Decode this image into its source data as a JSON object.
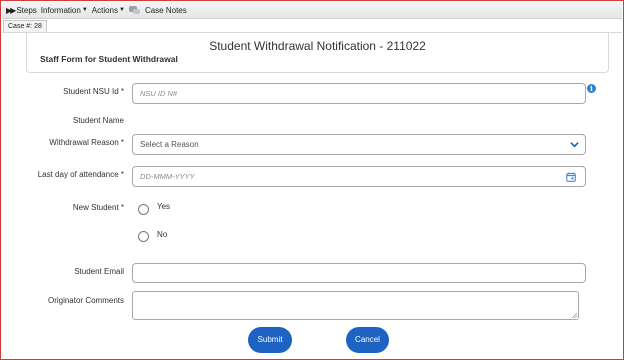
{
  "toolbar": {
    "steps_label": "Steps",
    "information_label": "Information",
    "actions_label": "Actions",
    "case_notes_label": "Case Notes"
  },
  "case_tab": {
    "label": "Case #: 28"
  },
  "header": {
    "title": "Student Withdrawal Notification - 211022",
    "form_title": "Staff Form for Student Withdrawal"
  },
  "form": {
    "student_nsu_id": {
      "label": "Student NSU Id *",
      "placeholder": "NSU ID N#",
      "value": ""
    },
    "student_name": {
      "label": "Student Name"
    },
    "withdrawal_reason": {
      "label": "Withdrawal Reason *",
      "selected": "Select a Reason"
    },
    "last_day": {
      "label": "Last day of attendance *",
      "placeholder": "DD-MMM-YYYY"
    },
    "new_student": {
      "label": "New Student *",
      "options": [
        "Yes",
        "No"
      ]
    },
    "student_email": {
      "label": "Student Email",
      "value": ""
    },
    "originator_comments": {
      "label": "Originator Comments",
      "value": ""
    }
  },
  "buttons": {
    "submit": "Submit",
    "cancel": "Cancel"
  },
  "colors": {
    "accent": "#1c63c3",
    "info": "#2f7fd3",
    "border_frame": "#d03c3c"
  },
  "icons": [
    "steps-icon",
    "case-notes-icon",
    "info-icon",
    "chevron-down-icon",
    "calendar-icon"
  ]
}
